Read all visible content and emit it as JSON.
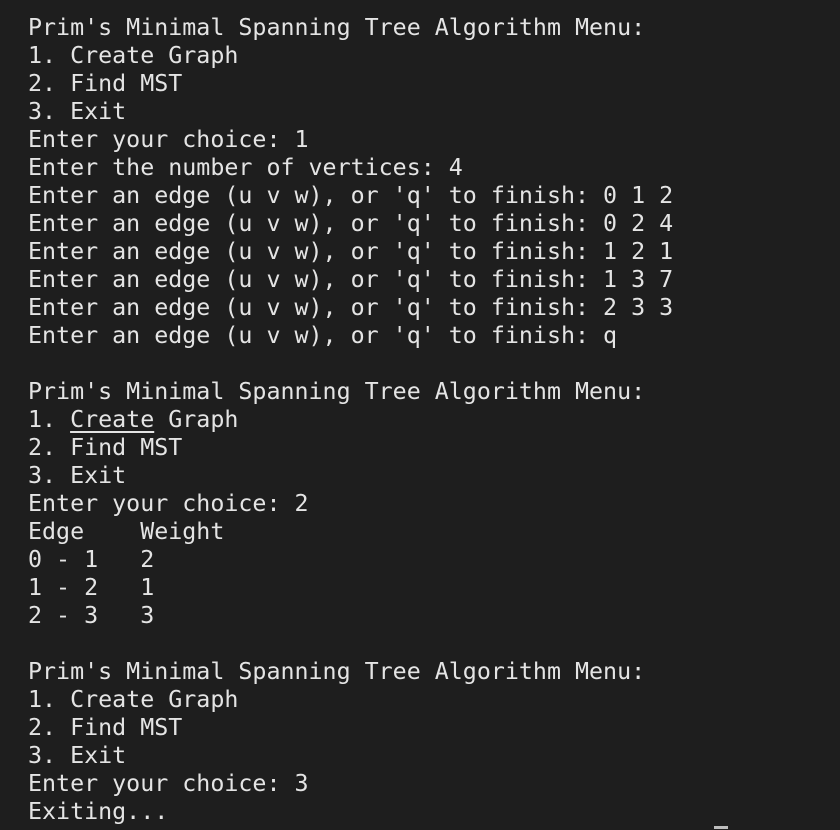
{
  "terminal": {
    "lines": [
      "Prim's Minimal Spanning Tree Algorithm Menu:",
      "1. Create Graph",
      "2. Find MST",
      "3. Exit",
      "Enter your choice: 1",
      "Enter the number of vertices: 4",
      "Enter an edge (u v w), or 'q' to finish: 0 1 2",
      "Enter an edge (u v w), or 'q' to finish: 0 2 4",
      "Enter an edge (u v w), or 'q' to finish: 1 2 1",
      "Enter an edge (u v w), or 'q' to finish: 1 3 7",
      "Enter an edge (u v w), or 'q' to finish: 2 3 3",
      "Enter an edge (u v w), or 'q' to finish: q",
      "",
      "Prim's Minimal Spanning Tree Algorithm Menu:",
      "1. Create Graph",
      "2. Find MST",
      "3. Exit",
      "Enter your choice: 2",
      "Edge    Weight",
      "0 - 1   2",
      "1 - 2   1",
      "2 - 3   3",
      "",
      "Prim's Minimal Spanning Tree Algorithm Menu:",
      "1. Create Graph",
      "2. Find MST",
      "3. Exit",
      "Enter your choice: 3",
      "Exiting..."
    ],
    "underlined_line_parts": {
      "prefix": "1. ",
      "word": "Create",
      "suffix": " Graph"
    }
  }
}
